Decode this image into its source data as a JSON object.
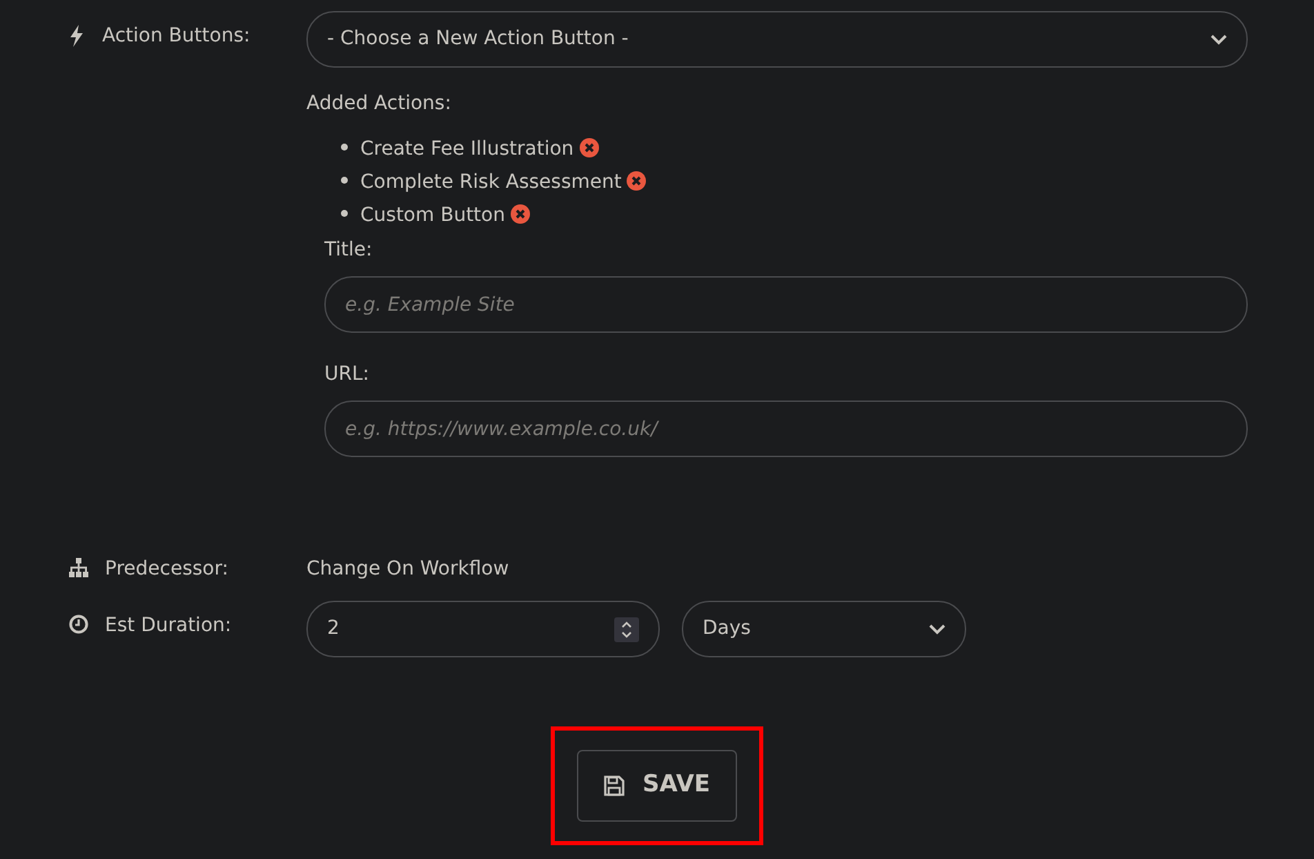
{
  "action_buttons": {
    "label": "Action Buttons:",
    "select": "- Choose a New Action Button -",
    "added_label": "Added Actions:",
    "actions": [
      {
        "text": "Create Fee Illustration",
        "kind": "plain"
      },
      {
        "text": "Complete Risk Assessment",
        "kind": "plain"
      },
      {
        "text": "Custom Button",
        "kind": "custom",
        "fields": [
          {
            "label": "Title:",
            "placeholder": "e.g. Example Site"
          },
          {
            "label": "URL:",
            "placeholder": "e.g. https://www.example.co.uk/"
          }
        ]
      }
    ]
  },
  "predecessor": {
    "label": "Predecessor:",
    "value": "Change On Workflow"
  },
  "duration": {
    "label": "Est Duration:",
    "value": "2",
    "unit": "Days"
  },
  "save": {
    "label": "SAVE",
    "highlighted": true
  }
}
